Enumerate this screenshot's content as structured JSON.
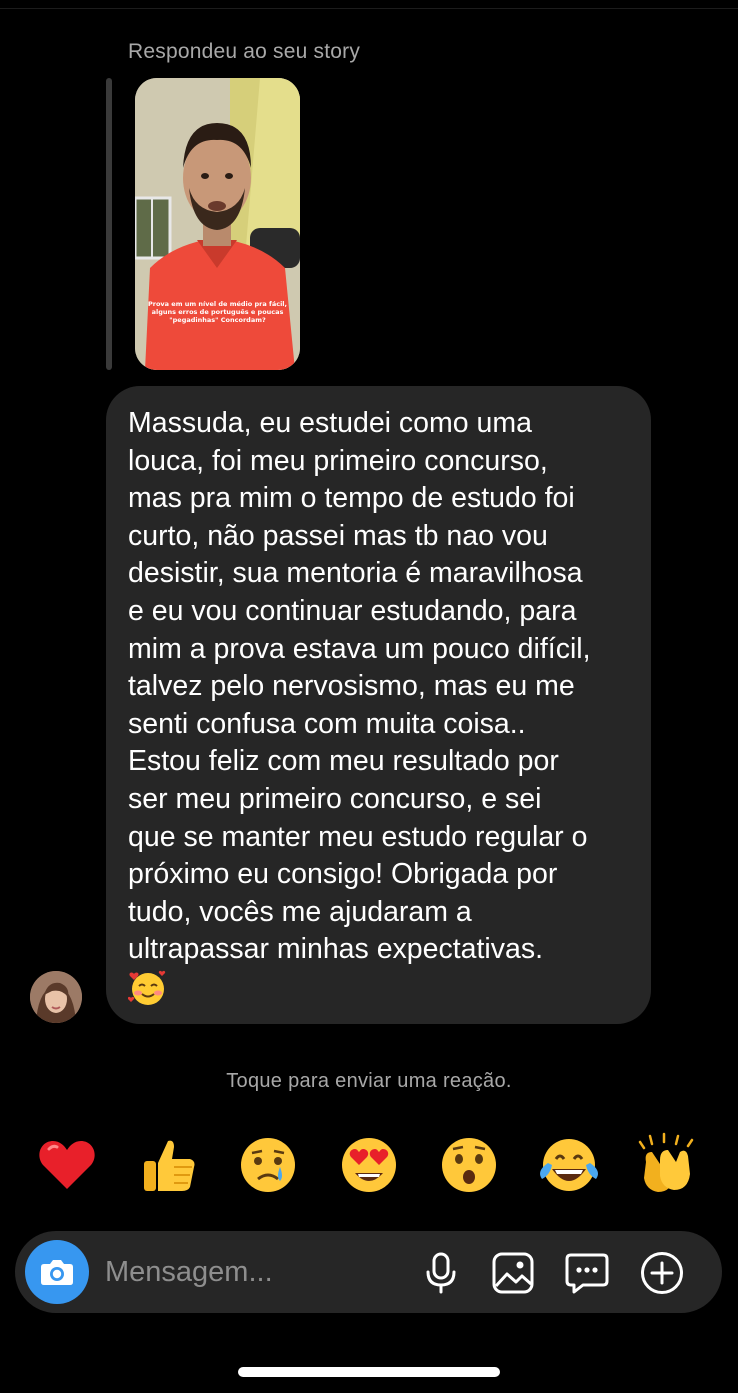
{
  "story": {
    "caption": "Respondeu ao seu story",
    "overlay_text": "Prova em um nível de médio pra fácil, alguns erros de português e poucas \"pegadinhas\" Concordam?"
  },
  "message": {
    "text": "Massuda, eu estudei como uma\nlouca, foi meu primeiro concurso,\nmas pra mim o tempo de estudo foi\ncurto, não passei mas tb nao vou\ndesistir, sua mentoria é maravilhosa\ne eu vou continuar estudando, para\nmim a prova estava um pouco difícil,\ntalvez pelo nervosismo, mas eu me\nsenti confusa com muita coisa..\nEstou feliz com meu resultado por\nser meu primeiro concurso, e sei\nque se manter meu estudo regular o\npróximo eu consigo! Obrigada por\ntudo, vocês me ajudaram a\nultrapassar minhas expectativas.",
    "emoji": "smiling-face-with-hearts-icon"
  },
  "reactions": {
    "hint": "Toque para enviar uma reação.",
    "items": [
      "heart-icon",
      "thumbs-up-icon",
      "crying-face-icon",
      "heart-eyes-icon",
      "surprised-face-icon",
      "tears-of-joy-icon",
      "clapping-hands-icon"
    ]
  },
  "composer": {
    "placeholder": "Mensagem...",
    "value": ""
  },
  "colors": {
    "background": "#000000",
    "bubble": "#262626",
    "accent": "#3797f0",
    "muted_text": "#a8a8a8"
  }
}
